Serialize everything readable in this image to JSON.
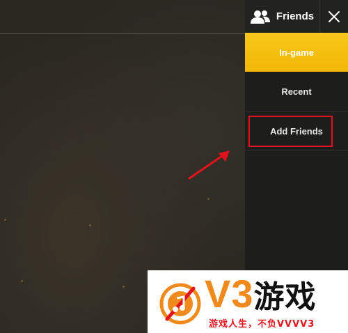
{
  "header": {
    "title": "Friends",
    "icon": "friends-icon",
    "close_icon": "close-icon"
  },
  "tabs": [
    {
      "label": "In-game",
      "active": true
    },
    {
      "label": "Recent",
      "active": false
    },
    {
      "label": "Add Friends",
      "active": false
    }
  ],
  "colors": {
    "accent": "#f2b705",
    "panel": "#1d1d1b",
    "highlight": "#e3121c",
    "watermark_orange": "#f08a1c"
  },
  "watermark": {
    "logo_text": "V3",
    "logo_cn": "游戏",
    "slogan": "游戏人生，不负VVVV3"
  }
}
